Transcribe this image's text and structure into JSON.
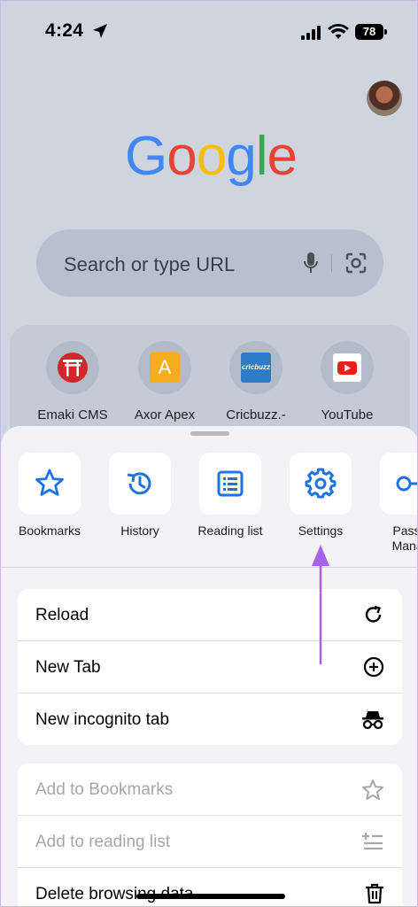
{
  "status": {
    "time": "4:24",
    "battery": "78"
  },
  "logo": [
    "G",
    "o",
    "o",
    "g",
    "l",
    "e"
  ],
  "search": {
    "placeholder": "Search or type URL"
  },
  "shortcuts": [
    {
      "label": "Emaki CMS"
    },
    {
      "label": "Axor Apex",
      "glyph": "A"
    },
    {
      "label": "Cricbuzz.-",
      "glyph": "cricbuzz"
    },
    {
      "label": "YouTube"
    }
  ],
  "actions": [
    {
      "label": "Bookmarks",
      "icon": "star-icon"
    },
    {
      "label": "History",
      "icon": "history-icon"
    },
    {
      "label": "Reading list",
      "icon": "reading-list-icon"
    },
    {
      "label": "Settings",
      "icon": "gear-icon"
    },
    {
      "label": "Passw",
      "label2": "Manag",
      "icon": "key-icon"
    }
  ],
  "menu_primary": [
    {
      "label": "Reload",
      "icon": "reload-icon"
    },
    {
      "label": "New Tab",
      "icon": "plus-circle-icon"
    },
    {
      "label": "New incognito tab",
      "icon": "incognito-icon"
    }
  ],
  "menu_secondary": [
    {
      "label": "Add to Bookmarks",
      "icon": "star-outline-icon",
      "disabled": true
    },
    {
      "label": "Add to reading list",
      "icon": "add-reading-list-icon",
      "disabled": true
    },
    {
      "label": "Delete browsing data",
      "icon": "trash-icon",
      "disabled": false
    }
  ],
  "colors": {
    "accent": "#1a73e8",
    "arrow": "#a561e8"
  }
}
